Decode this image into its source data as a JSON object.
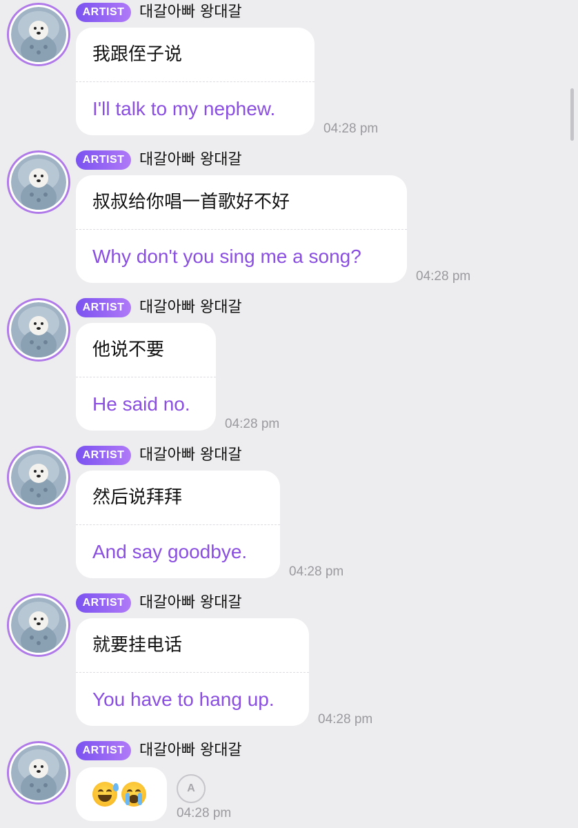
{
  "badge_label": "ARTIST",
  "sender_name": "대갈아빠 왕대갈",
  "accent_color": "#8a4fe0",
  "messages": [
    {
      "original": "我跟侄子说",
      "translation": "I'll talk to my nephew.",
      "time": "04:28 pm"
    },
    {
      "original": "叔叔给你唱一首歌好不好",
      "translation": "Why don't you sing me a song?",
      "time": "04:28 pm"
    },
    {
      "original": "他说不要",
      "translation": "He said no.",
      "time": "04:28 pm"
    },
    {
      "original": "然后说拜拜",
      "translation": "And say goodbye.",
      "time": "04:28 pm"
    },
    {
      "original": "就要挂电话",
      "translation": "You have to hang up.",
      "time": "04:28 pm"
    }
  ],
  "last_message": {
    "emojis": [
      "sweat-smile-emoji",
      "loudly-crying-emoji"
    ],
    "translate_icon": "translate-refresh-icon",
    "time": "04:28 pm"
  }
}
